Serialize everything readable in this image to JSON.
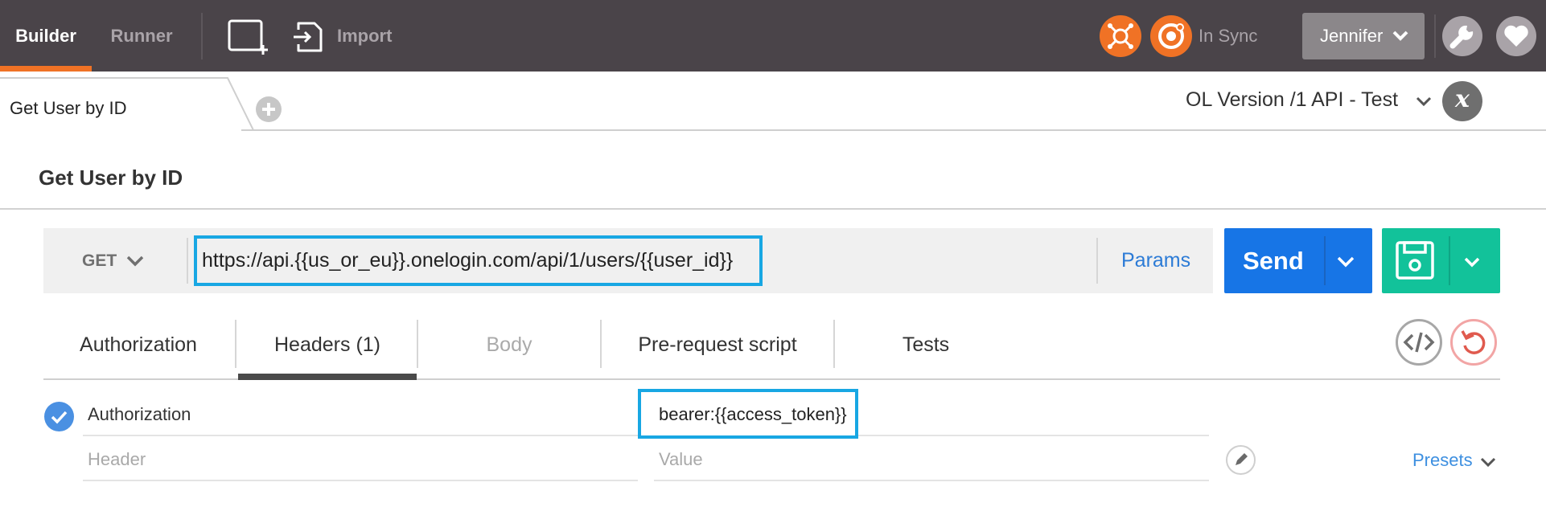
{
  "topbar": {
    "builder_label": "Builder",
    "runner_label": "Runner",
    "import_label": "Import",
    "sync_label": "In Sync",
    "user_label": "Jennifer",
    "accent_color": "#f07225",
    "icons": [
      "new-window-icon",
      "import-icon",
      "interceptor-icon",
      "sync-icon",
      "chevron-down-icon",
      "wrench-icon",
      "heart-icon"
    ]
  },
  "tabs": {
    "active_tab_label": "Get User by ID"
  },
  "environment": {
    "selected": "OL Version /1 API - Test",
    "quick_look_glyph": "x"
  },
  "request": {
    "name": "Get User by ID",
    "method": "GET",
    "url": "https://api.{{us_or_eu}}.onelogin.com/api/1/users/{{user_id}}",
    "params_label": "Params",
    "send_label": "Send"
  },
  "subtabs": {
    "authorization": "Authorization",
    "headers": "Headers (1)",
    "body": "Body",
    "prerequest": "Pre-request script",
    "tests": "Tests",
    "active": "Headers (1)"
  },
  "headers": {
    "rows": [
      {
        "key": "Authorization",
        "value": "bearer:{{access_token}}",
        "enabled": true
      }
    ],
    "key_placeholder": "Header",
    "value_placeholder": "Value",
    "presets_label": "Presets"
  },
  "colors": {
    "send_button": "#1775e6",
    "save_button": "#12c29a",
    "highlight_box": "#18a7e3",
    "link_blue": "#2c7bd6"
  }
}
